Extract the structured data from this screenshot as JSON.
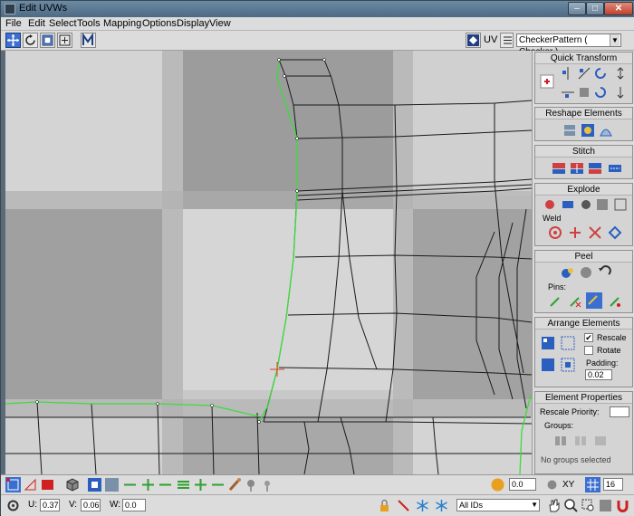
{
  "window": {
    "title": "Edit UVWs"
  },
  "menu": [
    "File",
    "Edit",
    "Select",
    "Tools",
    "Mapping",
    "Options",
    "Display",
    "View"
  ],
  "toolbar": {
    "uv_label": "UV",
    "texture_select": "CheckerPattern  ( Checker )"
  },
  "panel": {
    "quick_transform": {
      "title": "Quick Transform"
    },
    "reshape": {
      "title": "Reshape Elements"
    },
    "stitch": {
      "title": "Stitch"
    },
    "explode": {
      "title": "Explode",
      "weld_label": "Weld"
    },
    "peel": {
      "title": "Peel",
      "pins_label": "Pins:"
    },
    "arrange": {
      "title": "Arrange Elements",
      "rescale_label": "Rescale",
      "rescale_checked": "✔",
      "rotate_label": "Rotate",
      "padding_label": "Padding:",
      "padding_value": "0.02"
    },
    "element_props": {
      "title": "Element Properties",
      "rescale_priority_label": "Rescale Priority:",
      "groups_label": "Groups:",
      "no_groups": "No groups selected"
    }
  },
  "bottom": {
    "spinner_value": "0.0",
    "axis_label": "XY",
    "grid_value": "16",
    "u_label": "U:",
    "u_value": "0.37",
    "v_label": "V:",
    "v_value": "0.06",
    "w_label": "W:",
    "w_value": "0.0",
    "ids_select": "All IDs"
  },
  "colors": {
    "selection_edge": "#3cdc3c",
    "mesh_edge": "#1a1a1a",
    "checker_light": "#d2d2d2",
    "checker_dark": "#9a9a9a",
    "active_button": "#3a6fd0"
  }
}
